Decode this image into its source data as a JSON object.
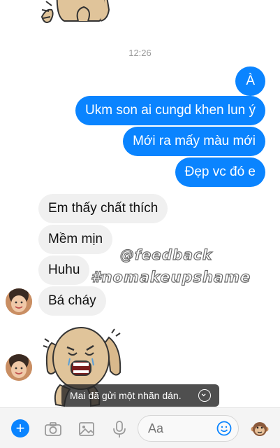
{
  "conversation": {
    "timestamp": "12:26",
    "outgoing": [
      "À",
      "Ukm son ai cungd khen lun ý",
      "Mới ra mấy màu mới",
      "Đẹp vc đó e"
    ],
    "incoming": [
      "Em thấy chất thích",
      "Mềm mịn",
      "Huhu",
      "Bá cháy"
    ]
  },
  "watermark": {
    "line1": "@feedback",
    "line2": "#nomakeupshame"
  },
  "toast": {
    "text": "Mai đã gửi một nhãn dán."
  },
  "composer": {
    "placeholder": "Aa"
  },
  "colors": {
    "accent": "#0a84ff",
    "incoming_bubble": "#f0f0f0",
    "bar": "#f4f4f4"
  },
  "icons": [
    "plus-icon",
    "camera-icon",
    "photo-icon",
    "microphone-icon",
    "smiley-icon",
    "monkey-icon",
    "chevron-down-icon"
  ]
}
